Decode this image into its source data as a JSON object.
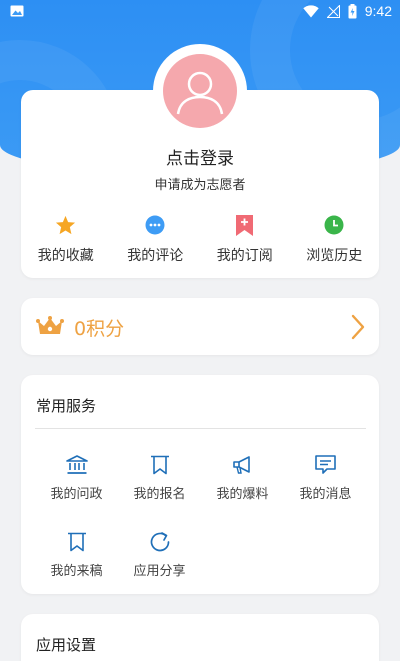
{
  "status_bar": {
    "time": "9:42"
  },
  "profile": {
    "login_label": "点击登录",
    "volunteer_label": "申请成为志愿者"
  },
  "quick_actions": [
    {
      "label": "我的收藏",
      "icon": "star-icon",
      "color": "#f6a623"
    },
    {
      "label": "我的评论",
      "icon": "comment-icon",
      "color": "#3e9cf5"
    },
    {
      "label": "我的订阅",
      "icon": "subscribe-bookmark-icon",
      "color": "#f06a74"
    },
    {
      "label": "浏览历史",
      "icon": "history-clock-icon",
      "color": "#3ab54a"
    }
  ],
  "points": {
    "label": "0积分",
    "color": "#eea243"
  },
  "services": {
    "title": "常用服务",
    "items": [
      {
        "label": "我的问政",
        "icon": "government-building-icon"
      },
      {
        "label": "我的报名",
        "icon": "bookmark-icon"
      },
      {
        "label": "我的爆料",
        "icon": "megaphone-icon"
      },
      {
        "label": "我的消息",
        "icon": "message-icon"
      },
      {
        "label": "我的来稿",
        "icon": "submission-bookmark-icon"
      },
      {
        "label": "应用分享",
        "icon": "share-icon"
      }
    ]
  },
  "settings": {
    "title": "应用设置"
  },
  "colors": {
    "header_blue": "#2d8ff3",
    "accent_orange": "#eea243",
    "icon_blue": "#1f6fb8"
  }
}
